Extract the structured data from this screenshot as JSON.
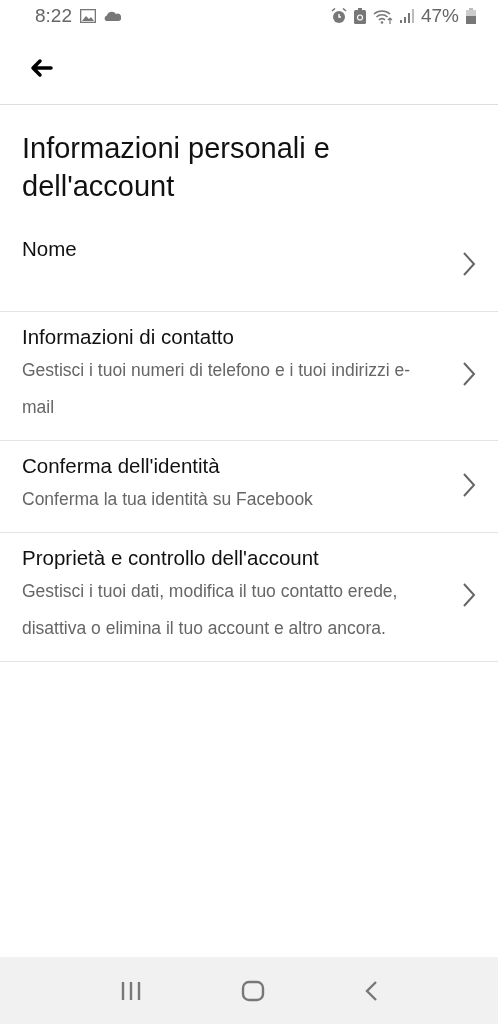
{
  "status_bar": {
    "time": "8:22",
    "battery": "47%"
  },
  "page": {
    "title": "Informazioni personali e dell'account"
  },
  "items": [
    {
      "title": "Nome"
    },
    {
      "title": "Informazioni di contatto",
      "description": "Gestisci i tuoi numeri di telefono e i tuoi indirizzi e-mail"
    },
    {
      "title": "Conferma dell'identità",
      "description": "Conferma la tua identità su Facebook"
    },
    {
      "title": "Proprietà e controllo dell'account",
      "description": "Gestisci i tuoi dati, modifica il tuo contatto erede, disattiva o elimina il tuo account e altro ancora."
    }
  ]
}
